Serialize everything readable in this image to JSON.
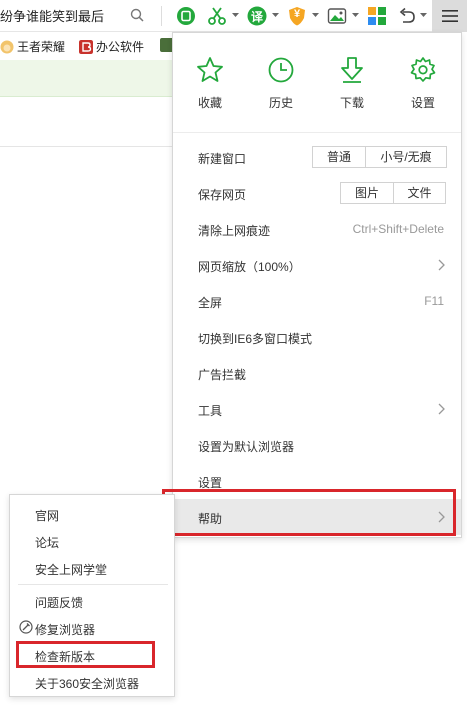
{
  "address_bar": {
    "text": "纷争谁能笑到最后"
  },
  "toolbar": {
    "icons": [
      "search-icon",
      "shield-app-icon",
      "scissors-icon",
      "translate-icon",
      "money-shield-icon",
      "image-icon",
      "apps-grid-icon",
      "undo-icon",
      "menu-icon"
    ],
    "translate_glyph": "译",
    "money_glyph": "¥"
  },
  "bookmarks": [
    {
      "label": "王者荣耀",
      "icon": "game-avatar-icon"
    },
    {
      "label": "办公软件",
      "icon": "office-logo-icon"
    }
  ],
  "colors": {
    "accent_green": "#23a83c",
    "highlight_red": "#d9262b",
    "hover_gray": "#e9e9e9"
  },
  "menu": {
    "quick_actions": [
      {
        "label": "收藏",
        "icon": "star-icon"
      },
      {
        "label": "历史",
        "icon": "clock-icon"
      },
      {
        "label": "下载",
        "icon": "download-icon"
      },
      {
        "label": "设置",
        "icon": "gear-icon"
      }
    ],
    "new_window": {
      "label": "新建窗口",
      "options": [
        "普通",
        "小号/无痕"
      ]
    },
    "save_page": {
      "label": "保存网页",
      "options": [
        "图片",
        "文件"
      ]
    },
    "clear_history": {
      "label": "清除上网痕迹",
      "shortcut": "Ctrl+Shift+Delete"
    },
    "zoom": {
      "label": "网页缩放（100%）"
    },
    "fullscreen": {
      "label": "全屏",
      "shortcut": "F11"
    },
    "ie6_mode": {
      "label": "切换到IE6多窗口模式"
    },
    "ad_block": {
      "label": "广告拦截"
    },
    "tools": {
      "label": "工具"
    },
    "default_browser": {
      "label": "设置为默认浏览器"
    },
    "settings": {
      "label": "设置"
    },
    "help": {
      "label": "帮助"
    }
  },
  "help_submenu": {
    "items": [
      "官网",
      "论坛",
      "安全上网学堂",
      "问题反馈",
      "修复浏览器",
      "检查新版本",
      "关于360安全浏览器"
    ],
    "repair_icon": "repair-icon"
  }
}
